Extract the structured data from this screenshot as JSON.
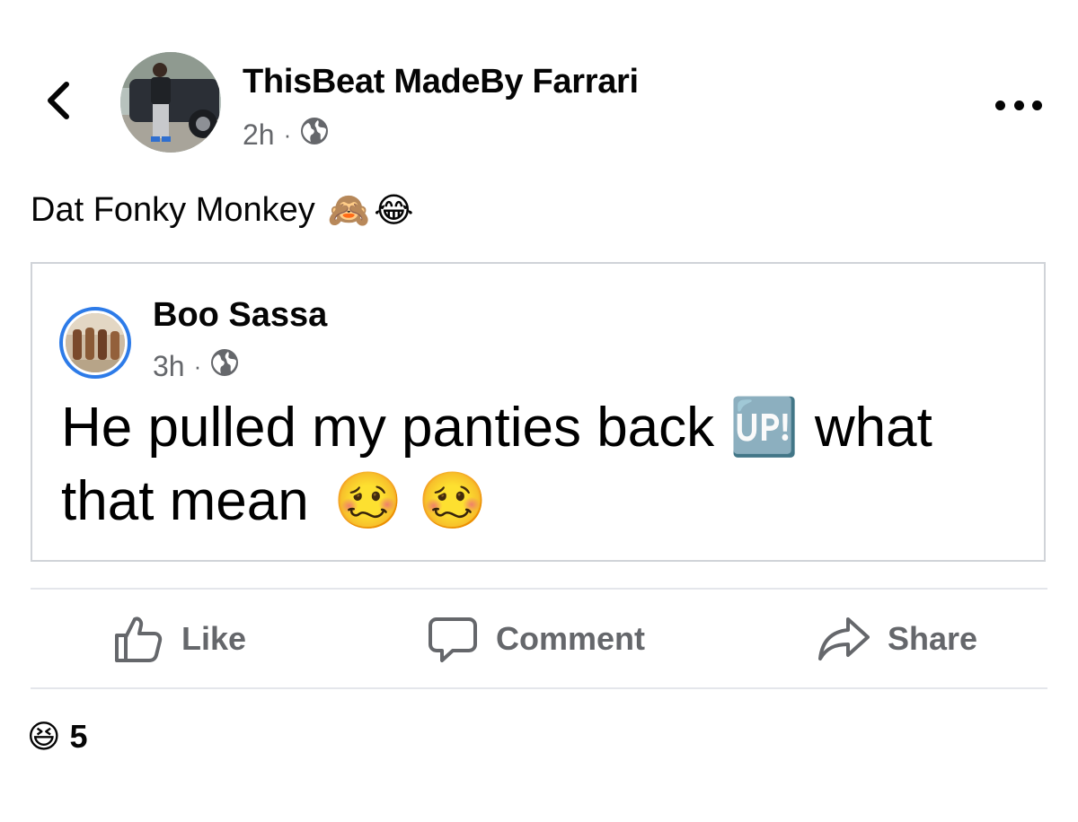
{
  "header": {
    "back_icon": "chevron-left-icon",
    "author_name": "ThisBeat MadeBy Farrari",
    "time": "2h",
    "separator": "·",
    "privacy_icon": "globe-icon",
    "more_icon": "more-options-icon"
  },
  "post": {
    "caption": "Dat Fonky Monkey",
    "caption_emojis": [
      "🙈",
      "😂"
    ]
  },
  "shared_post": {
    "author_name": "Boo Sassa",
    "time": "3h",
    "separator": "·",
    "privacy_icon": "globe-icon",
    "text_part1": "He pulled my panties back",
    "emoji_up": "🆙",
    "text_part2": "what that mean",
    "trailing_emojis": [
      "🥴",
      "🥴"
    ]
  },
  "actions": {
    "like_label": "Like",
    "comment_label": "Comment",
    "share_label": "Share"
  },
  "reactions": {
    "emoji": "😆",
    "count": "5"
  },
  "colors": {
    "text_primary": "#050505",
    "text_secondary": "#65676b",
    "divider": "#e4e6eb",
    "card_border": "#d0d3d8",
    "avatar_ring": "#2d7be8"
  }
}
